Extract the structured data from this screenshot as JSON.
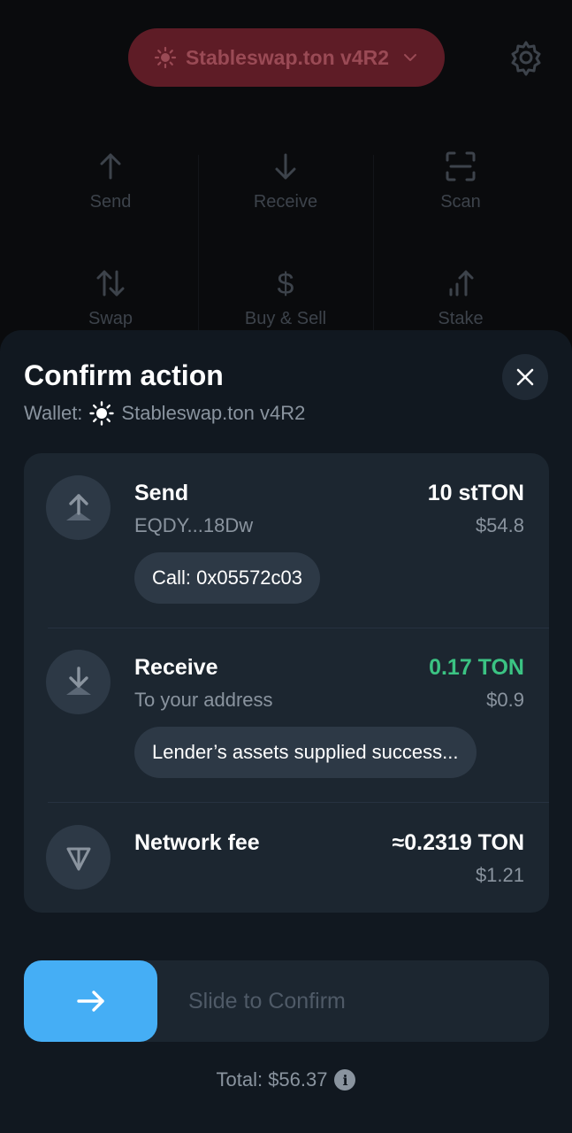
{
  "background": {
    "wallet_name": "Stableswap.ton v4R2",
    "actions": [
      {
        "label": "Send",
        "icon": "arrow-up-icon"
      },
      {
        "label": "Receive",
        "icon": "arrow-down-icon"
      },
      {
        "label": "Scan",
        "icon": "scan-icon"
      },
      {
        "label": "Swap",
        "icon": "swap-icon"
      },
      {
        "label": "Buy & Sell",
        "icon": "dollar-icon"
      },
      {
        "label": "Stake",
        "icon": "stake-icon"
      }
    ]
  },
  "sheet": {
    "title": "Confirm action",
    "wallet_prefix": "Wallet:",
    "wallet_name": "Stableswap.ton v4R2",
    "rows": [
      {
        "title": "Send",
        "subtitle": "EQDY...18Dw",
        "amount": "10 stTON",
        "fiat": "$54.8",
        "chip": "Call: 0x05572c03",
        "icon": "send-arrow-icon"
      },
      {
        "title": "Receive",
        "subtitle": "To your address",
        "amount": "0.17 TON",
        "fiat": "$0.9",
        "chip": "Lender’s assets supplied success...",
        "icon": "receive-arrow-icon"
      },
      {
        "title": "Network fee",
        "amount": "≈0.2319 TON",
        "fiat": "$1.21",
        "icon": "ton-logo-icon"
      }
    ],
    "slider_label": "Slide to Confirm",
    "total": "Total: $56.37"
  },
  "colors": {
    "accent": "#45aef5",
    "positive": "#3bc383",
    "wallet_pill": "#5e1c26"
  }
}
